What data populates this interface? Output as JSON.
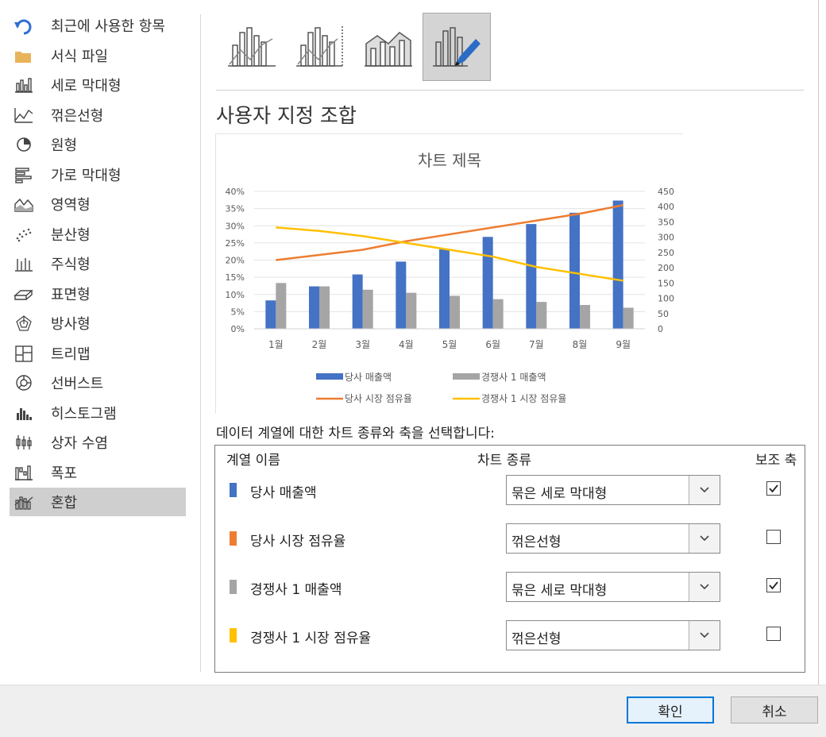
{
  "sidebar": {
    "items": [
      {
        "label": "최근에 사용한 항목",
        "icon": "recent-undo-icon"
      },
      {
        "label": "서식 파일",
        "icon": "folder-icon"
      },
      {
        "label": "세로 막대형",
        "icon": "column-chart-icon"
      },
      {
        "label": "꺾은선형",
        "icon": "line-chart-icon"
      },
      {
        "label": "원형",
        "icon": "pie-chart-icon"
      },
      {
        "label": "가로 막대형",
        "icon": "bar-chart-icon"
      },
      {
        "label": "영역형",
        "icon": "area-chart-icon"
      },
      {
        "label": "분산형",
        "icon": "scatter-chart-icon"
      },
      {
        "label": "주식형",
        "icon": "stock-chart-icon"
      },
      {
        "label": "표면형",
        "icon": "surface-chart-icon"
      },
      {
        "label": "방사형",
        "icon": "radar-chart-icon"
      },
      {
        "label": "트리맵",
        "icon": "treemap-chart-icon"
      },
      {
        "label": "선버스트",
        "icon": "sunburst-chart-icon"
      },
      {
        "label": "히스토그램",
        "icon": "histogram-chart-icon"
      },
      {
        "label": "상자 수염",
        "icon": "box-whisker-chart-icon"
      },
      {
        "label": "폭포",
        "icon": "waterfall-chart-icon"
      },
      {
        "label": "혼합",
        "icon": "combo-chart-icon"
      }
    ],
    "selected_index": 16
  },
  "subtypes": {
    "icons": [
      "clustered-column-line-icon",
      "clustered-column-line-secondary-axis-icon",
      "stacked-area-clustered-column-icon",
      "custom-combination-icon"
    ],
    "selected_index": 3
  },
  "subtitle": "사용자 지정 조합",
  "chart_data": {
    "type": "combo",
    "title": "차트 제목",
    "categories": [
      "1월",
      "2월",
      "3월",
      "4월",
      "5월",
      "6월",
      "7월",
      "8월",
      "9월"
    ],
    "y_left": {
      "ticks": [
        "0%",
        "5%",
        "10%",
        "15%",
        "20%",
        "25%",
        "30%",
        "35%",
        "40%"
      ],
      "range": [
        0,
        0.4
      ]
    },
    "y_right": {
      "ticks": [
        "0",
        "50",
        "100",
        "150",
        "200",
        "250",
        "300",
        "350",
        "400",
        "450"
      ],
      "range": [
        0,
        450
      ]
    },
    "series": [
      {
        "name": "당사 매출액",
        "kind": "bar",
        "axis": "right",
        "color": "#4472c4",
        "values": [
          93,
          139,
          178,
          220,
          262,
          301,
          343,
          380,
          420
        ]
      },
      {
        "name": "경쟁사 1 매출액",
        "kind": "bar",
        "axis": "right",
        "color": "#a5a5a5",
        "values": [
          150,
          139,
          128,
          118,
          108,
          97,
          88,
          78,
          69
        ]
      },
      {
        "name": "당사 시장 점유율",
        "kind": "line",
        "axis": "left",
        "color": "#ed7d31",
        "values": [
          0.2,
          0.215,
          0.23,
          0.255,
          0.275,
          0.295,
          0.315,
          0.335,
          0.36
        ]
      },
      {
        "name": "경쟁사 1 시장 점유율",
        "kind": "line",
        "axis": "left",
        "color": "#ffc000",
        "values": [
          0.295,
          0.285,
          0.27,
          0.25,
          0.23,
          0.21,
          0.18,
          0.16,
          0.14
        ]
      }
    ],
    "legend_position": "bottom",
    "grid": true
  },
  "instruction": "데이터 계열에 대한 차트 종류와 축을 선택합니다:",
  "table": {
    "headers": {
      "name": "계열 이름",
      "type": "차트 종류",
      "axis": "보조 축"
    },
    "rows": [
      {
        "name": "당사 매출액",
        "color": "#4472c4",
        "type": "묶은 세로 막대형",
        "secondary": true
      },
      {
        "name": "당사 시장 점유율",
        "color": "#ed7d31",
        "type": "꺾은선형",
        "secondary": false
      },
      {
        "name": "경쟁사 1 매출액",
        "color": "#a5a5a5",
        "type": "묶은 세로 막대형",
        "secondary": true
      },
      {
        "name": "경쟁사 1 시장 점유율",
        "color": "#ffc000",
        "type": "꺾은선형",
        "secondary": false
      }
    ]
  },
  "footer": {
    "ok": "확인",
    "cancel": "취소"
  }
}
